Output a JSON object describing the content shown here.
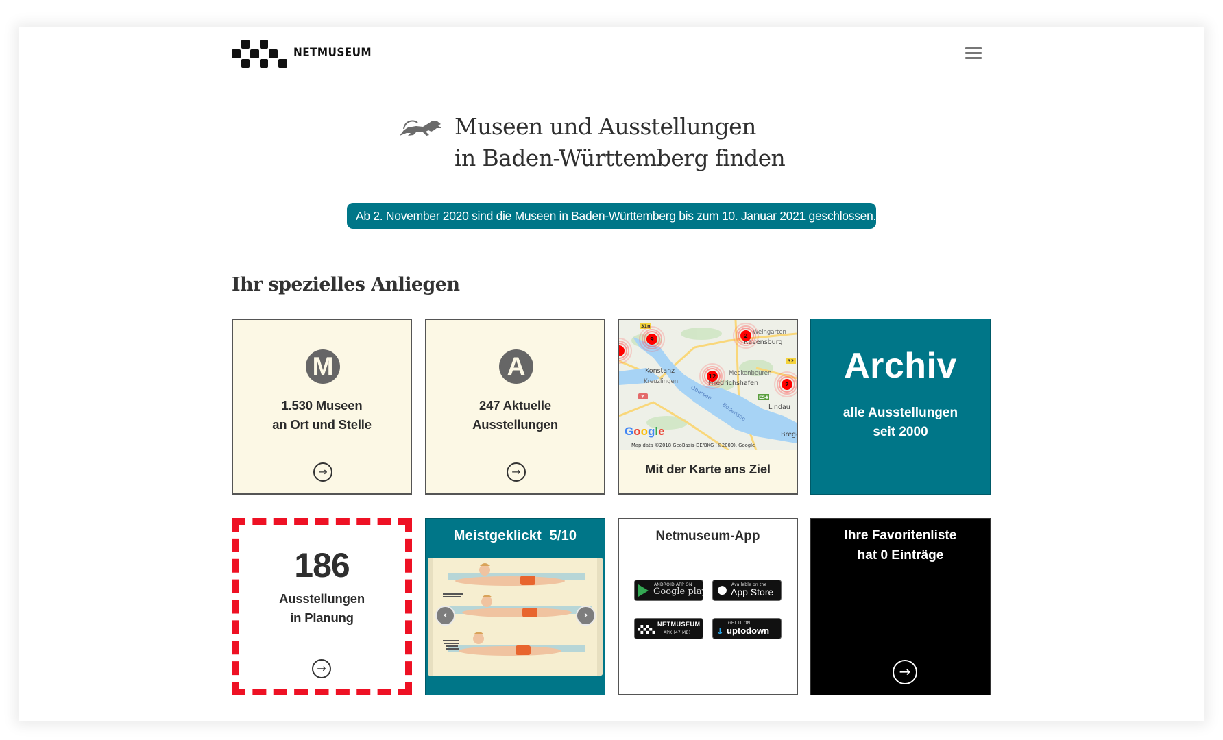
{
  "header": {
    "brand": "NETMUSEUM",
    "menu_icon": "hamburger-menu-icon"
  },
  "hero": {
    "icon": "lion-icon",
    "title_line1": "Museen und Ausstellungen",
    "title_line2": "in Baden-Württemberg finden"
  },
  "banner": {
    "text": "Ab 2. November 2020 sind die Museen in Baden-Württemberg bis zum 10. Januar 2021 geschlossen."
  },
  "section": {
    "heading": "Ihr spezielles Anliegen"
  },
  "tiles": {
    "museums": {
      "icon_letter": "M",
      "line1": "1.530 Museen",
      "line2": "an Ort und Stelle",
      "arrow": "→"
    },
    "exhibitions": {
      "icon_letter": "A",
      "line1": "247 Aktuelle",
      "line2": "Ausstellungen",
      "arrow": "→"
    },
    "map": {
      "caption": "Mit der Karte ans Ziel",
      "labels": {
        "konstanz": "Konstanz",
        "kreuzlingen": "Kreuzlingen",
        "meckenbeuren": "Meckenbeuren",
        "friedrichshafen": "Friedrichshafen",
        "lindau": "Lindau",
        "weingarten": "Weingarten",
        "ravensburg": "Ravensburg",
        "obersee": "Obersee",
        "bodensee": "Bodensee",
        "bregenz": "Brege",
        "google": "Google",
        "attribution": "Map data ©2018 GeoBasis-DE/BKG (©2009), Google",
        "road_31n": "31n",
        "road_32": "32",
        "road_e54": "E54",
        "road_7": "7"
      },
      "markers": [
        "9",
        "2",
        "12",
        "2",
        ""
      ]
    },
    "archive": {
      "title": "Archiv",
      "line1": "alle Ausstellungen",
      "line2": "seit 2000"
    },
    "planned": {
      "count": "186",
      "line1": "Ausstellungen",
      "line2": "in Planung",
      "arrow": "→"
    },
    "most_clicked": {
      "label": "Meistgeklickt",
      "position": "5/10",
      "prev": "‹",
      "next": "›"
    },
    "app": {
      "title": "Netmuseum-App",
      "google_play": {
        "small": "ANDROID APP ON",
        "big": "Google play"
      },
      "app_store": {
        "small": "Available on the",
        "big": "App Store"
      },
      "apk": {
        "big": "NETMUSEUM",
        "small": "APK (47 MB)"
      },
      "uptodown": {
        "small": "GET IT ON",
        "big": "uptodown"
      }
    },
    "favorites": {
      "line1": "Ihre Favoritenliste",
      "line2": "hat 0 Einträge",
      "arrow": "→"
    }
  },
  "colors": {
    "teal": "#007688",
    "cream": "#fcf8e5",
    "dashed_red": "#ee1124"
  }
}
